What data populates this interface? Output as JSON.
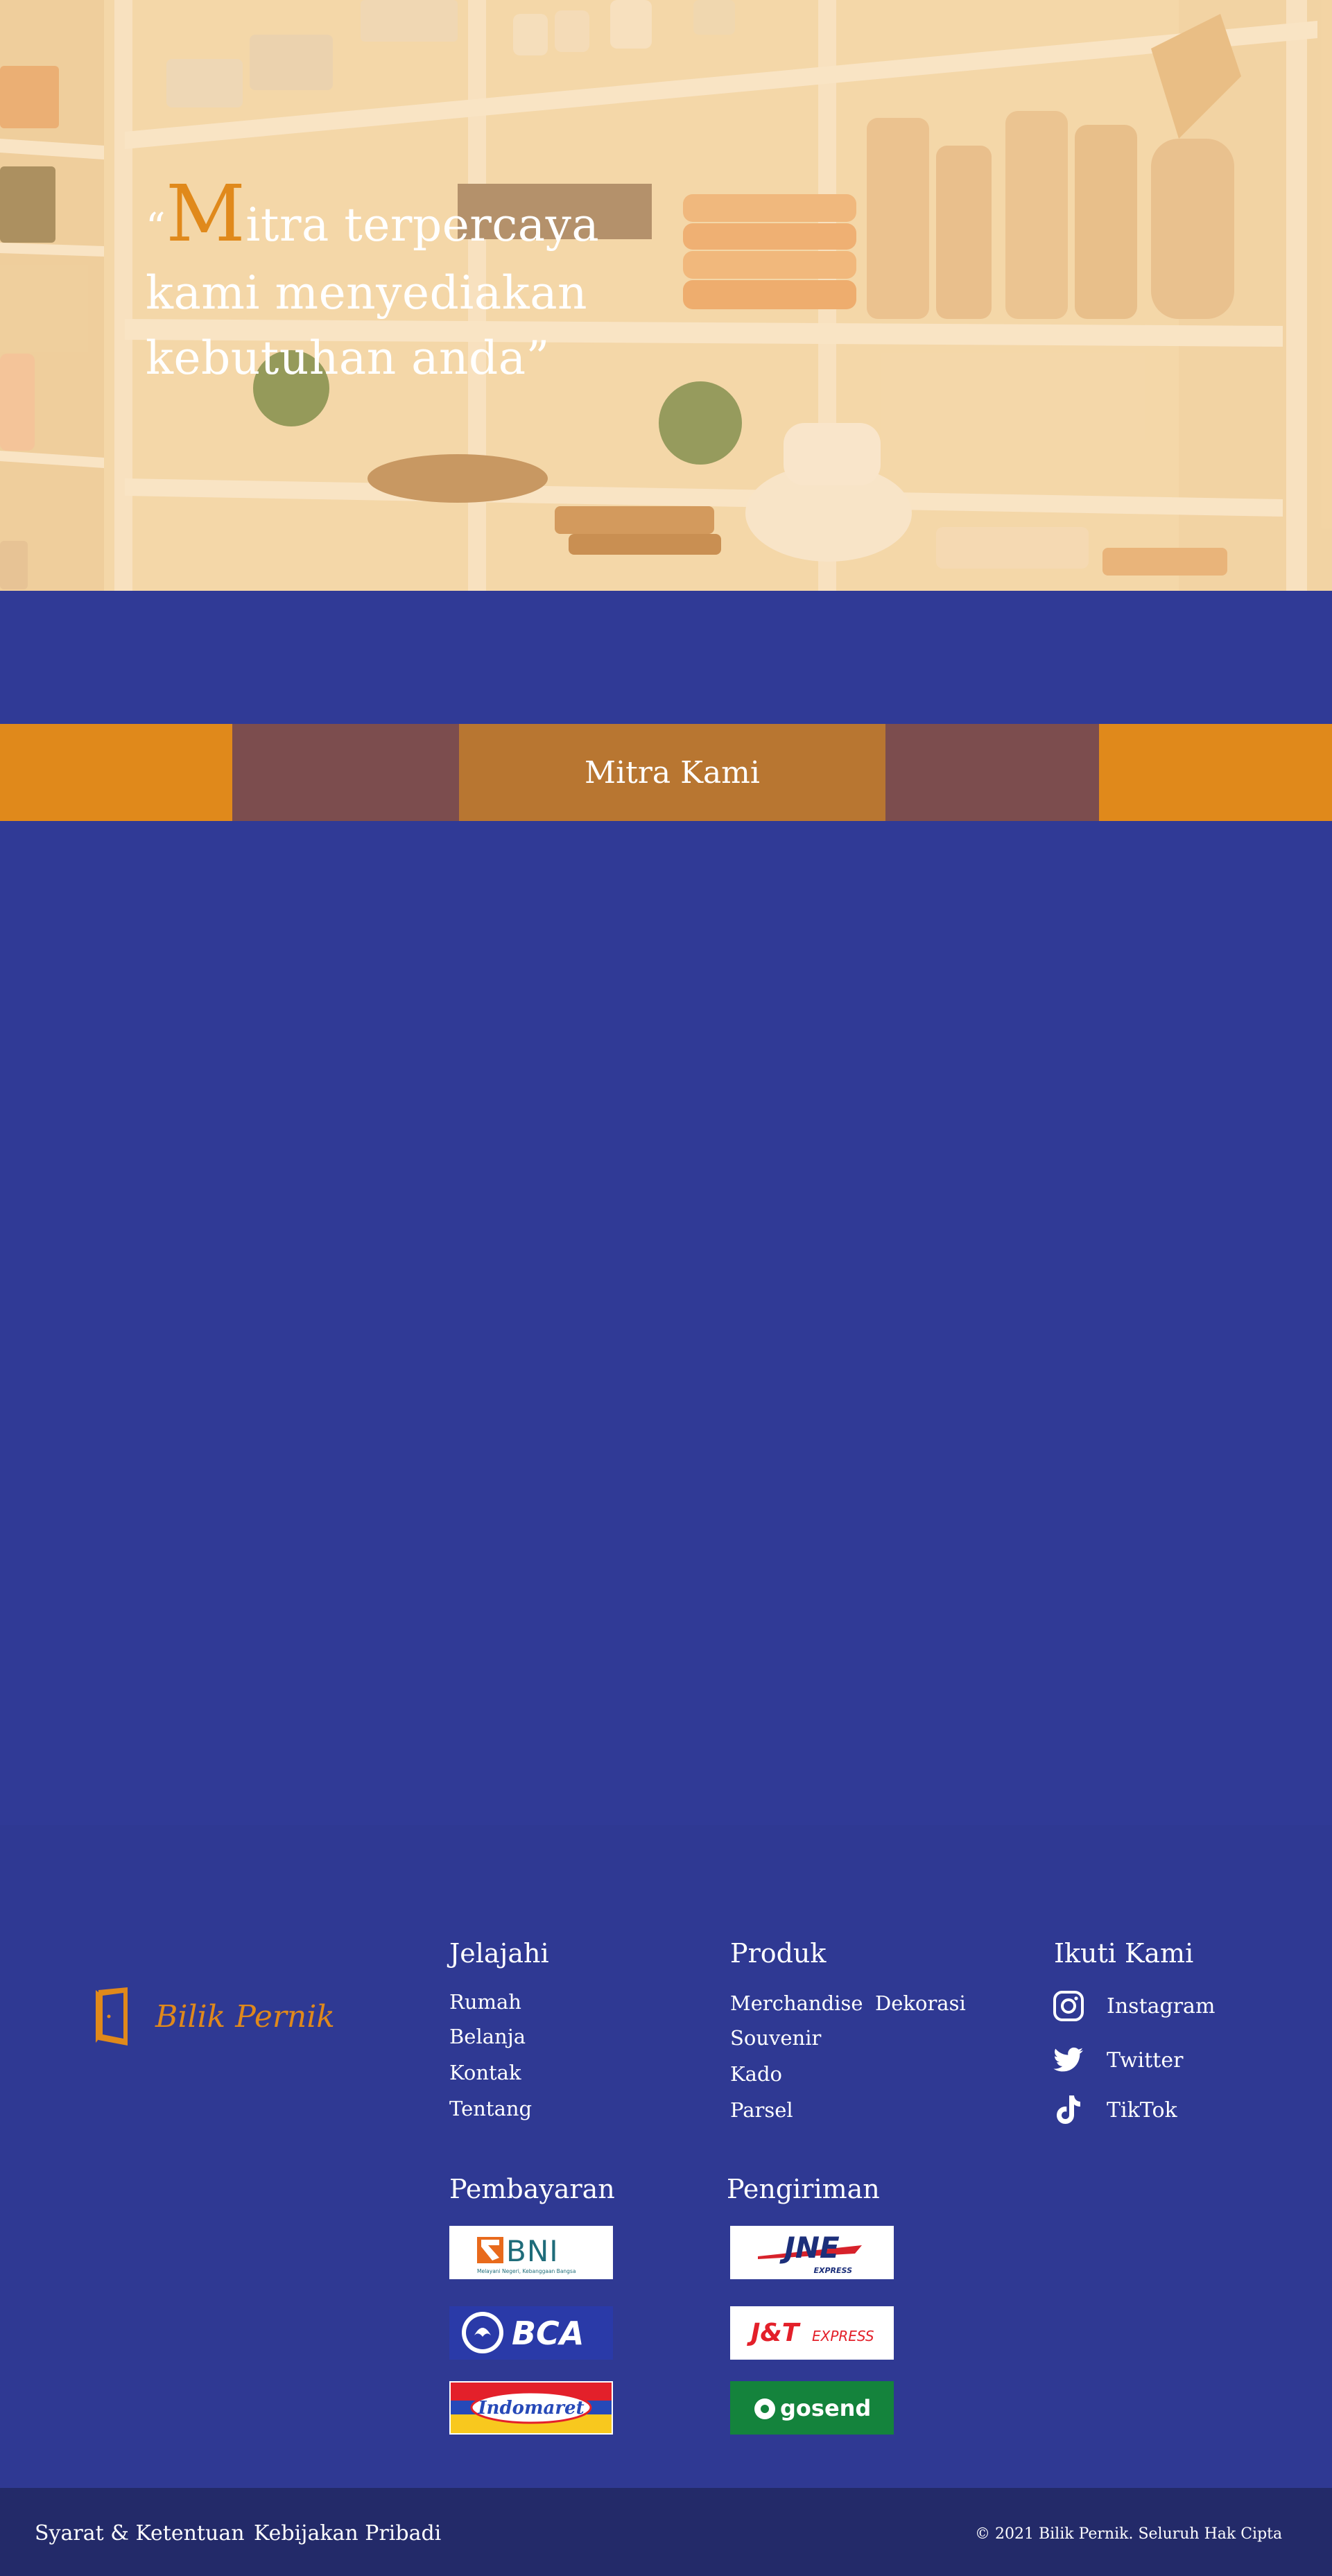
{
  "hero": {
    "quote_open": "“",
    "quote_cap": "M",
    "quote_line1": "itra terpercaya",
    "quote_line2": "kami menyediakan",
    "quote_line3": "kebutuhan anda”"
  },
  "partners": {
    "title": "Mitra Kami"
  },
  "footer": {
    "brand": "Bilik Pernik",
    "explore": {
      "title": "Jelajahi",
      "links": [
        "Rumah",
        "Belanja",
        "Kontak",
        "Tentang"
      ]
    },
    "products": {
      "title": "Produk",
      "links": [
        "Merchandise",
        "Dekorasi",
        "Souvenir",
        "Kado",
        "Parsel"
      ]
    },
    "follow": {
      "title": "Ikuti Kami",
      "items": [
        {
          "label": "Instagram",
          "icon": "instagram-icon"
        },
        {
          "label": "Twitter",
          "icon": "twitter-icon"
        },
        {
          "label": "TikTok",
          "icon": "tiktok-icon"
        }
      ]
    },
    "payment": {
      "title": "Pembayaran",
      "logos": [
        "BNI",
        "BCA",
        "Indomaret"
      ],
      "bni_tagline": "Melayani Negeri, Kebanggaan Bangsa"
    },
    "shipping": {
      "title": "Pengiriman",
      "logos": [
        "JNE",
        "J&T",
        "gosend"
      ],
      "jne_sub": "EXPRESS",
      "jt_sub": "EXPRESS"
    },
    "bottom": {
      "terms": "Syarat & Ketentuan",
      "privacy": "Kebijakan Pribadi",
      "copyright": "© 2021 Bilik Pernik. Seluruh Hak Cipta"
    }
  },
  "colors": {
    "primary_blue": "#303a96",
    "accent_orange": "#e0891b",
    "band_brown": "#7c4d4e",
    "band_center": "#b87631",
    "footer_dark": "#232a69"
  }
}
